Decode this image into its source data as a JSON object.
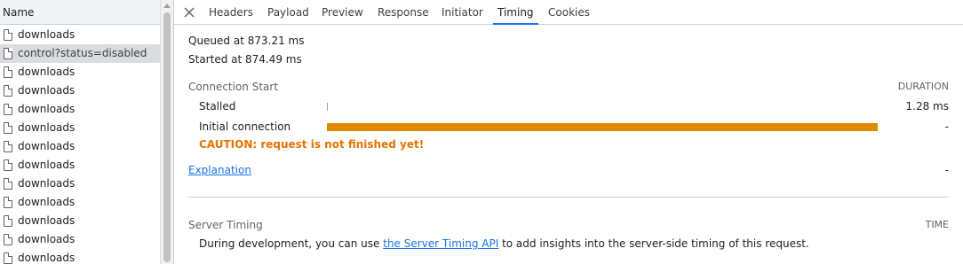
{
  "request_list": {
    "header": "Name",
    "items": [
      {
        "label": "downloads",
        "selected": false
      },
      {
        "label": "control?status=disabled",
        "selected": true
      },
      {
        "label": "downloads",
        "selected": false
      },
      {
        "label": "downloads",
        "selected": false
      },
      {
        "label": "downloads",
        "selected": false
      },
      {
        "label": "downloads",
        "selected": false
      },
      {
        "label": "downloads",
        "selected": false
      },
      {
        "label": "downloads",
        "selected": false
      },
      {
        "label": "downloads",
        "selected": false
      },
      {
        "label": "downloads",
        "selected": false
      },
      {
        "label": "downloads",
        "selected": false
      },
      {
        "label": "downloads",
        "selected": false
      },
      {
        "label": "downloads",
        "selected": false
      }
    ]
  },
  "tabs": [
    "Headers",
    "Payload",
    "Preview",
    "Response",
    "Initiator",
    "Timing",
    "Cookies"
  ],
  "active_tab": "Timing",
  "timing": {
    "queued": "Queued at 873.21 ms",
    "started": "Started at 874.49 ms",
    "section_title": "Connection Start",
    "duration_header": "DURATION",
    "stalled_label": "Stalled",
    "stalled_value": "1.28 ms",
    "initial_label": "Initial connection",
    "initial_value": "-",
    "caution": "CAUTION: request is not finished yet!",
    "explanation": "Explanation",
    "explanation_value": "-",
    "bar_color": "#e08a00"
  },
  "server_timing": {
    "title": "Server Timing",
    "time_header": "TIME",
    "text_before": "During development, you can use ",
    "link": "the Server Timing API",
    "text_after": " to add insights into the server-side timing of this request."
  }
}
